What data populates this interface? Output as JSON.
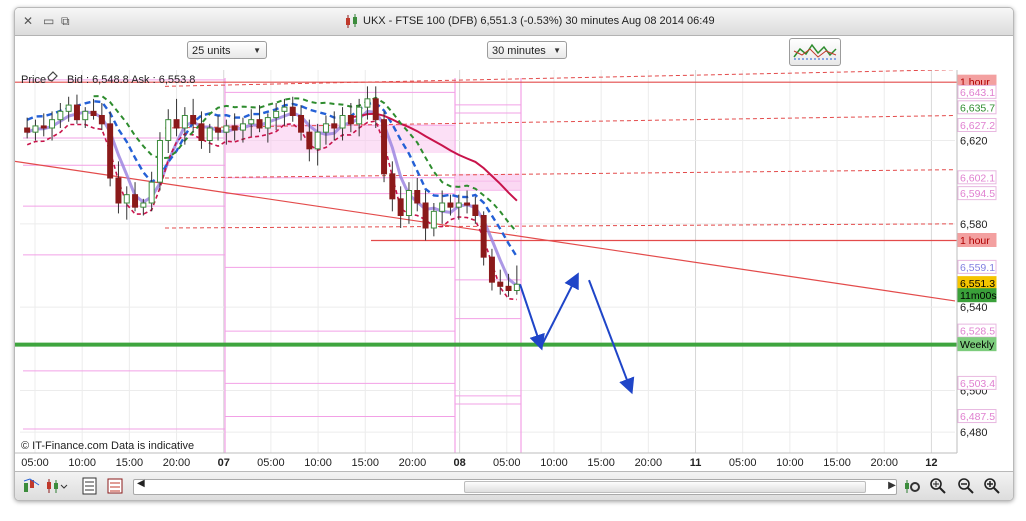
{
  "window": {
    "title": "UKX - FTSE 100 (DFB)   6,551.3 (-0.53%)   30 minutes  Aug 08 2014 06:49",
    "title_icons": [
      "close-icon",
      "minimize-icon",
      "detach-icon",
      "candlestick-icon"
    ]
  },
  "controls": {
    "units_select": "25 units",
    "timeframe_select": "30 minutes"
  },
  "chart": {
    "price_label": "Price",
    "bid_ask": "Bid : 6,548.8  Ask : 6,553.8",
    "watermark": "© IT-Finance.com  Data is indicative",
    "colors": {
      "candle_up": "#3c8c3c",
      "candle_down": "#8b1a1a",
      "resistance": "#e34b4b",
      "pink_lines": "#f2a0e6",
      "weekly": "#3ea53e",
      "blue_dash": "#2460d6",
      "ma_lavender": "#9d86e0",
      "maroon": "#c8144b",
      "green_dash": "#2e8c2e",
      "arrow": "#1f45c8"
    }
  },
  "chart_data": {
    "type": "candlestick",
    "instrument": "UKX - FTSE 100 (DFB)",
    "timeframe": "30 minutes",
    "last_price": 6551.3,
    "change_pct": -0.53,
    "ylim": [
      6470,
      6650
    ],
    "x_ticks": [
      "05:00",
      "10:00",
      "15:00",
      "20:00",
      "07",
      "05:00",
      "10:00",
      "15:00",
      "20:00",
      "08",
      "05:00",
      "10:00",
      "15:00",
      "20:00",
      "11",
      "05:00",
      "10:00",
      "15:00",
      "20:00",
      "12"
    ],
    "y_axis": {
      "ticks": [
        {
          "value": 6620,
          "label": "6,620"
        },
        {
          "value": 6580,
          "label": "6,580"
        },
        {
          "value": 6540,
          "label": "6,540"
        },
        {
          "value": 6500,
          "label": "6,500"
        },
        {
          "value": 6480,
          "label": "6,480"
        }
      ],
      "markers": [
        {
          "label": "1 hour",
          "value": 6648,
          "color": "#f3a0a0",
          "text": "#b00000"
        },
        {
          "label": "6,643.1",
          "value": 6643.1,
          "color": "#ffffff",
          "text": "#e080d0"
        },
        {
          "label": "6,635.7",
          "value": 6635.7,
          "color": "#ffffff",
          "text": "#2e8c2e"
        },
        {
          "label": "6,627.2",
          "value": 6627.2,
          "color": "#ffffff",
          "text": "#e080d0"
        },
        {
          "label": "6,602.1",
          "value": 6602.1,
          "color": "#ffffff",
          "text": "#e080d0"
        },
        {
          "label": "6,594.5",
          "value": 6594.5,
          "color": "#ffffff",
          "text": "#e080d0"
        },
        {
          "label": "1 hour",
          "value": 6572,
          "color": "#f3a0a0",
          "text": "#b00000"
        },
        {
          "label": "6,559.1",
          "value": 6559.1,
          "color": "#ffffff",
          "text": "#8080e0"
        },
        {
          "label": "6,551.3",
          "value": 6551.3,
          "color": "#f5c400",
          "text": "#000000"
        },
        {
          "label": "11m00s",
          "value": 6545.5,
          "color": "#3aa03a",
          "text": "#000000"
        },
        {
          "label": "6,528.5",
          "value": 6528.5,
          "color": "#ffffff",
          "text": "#e080d0"
        },
        {
          "label": "Weekly",
          "value": 6522,
          "color": "#7ccc7c",
          "text": "#000000"
        },
        {
          "label": "6,503.4",
          "value": 6503.4,
          "color": "#ffffff",
          "text": "#e080d0"
        },
        {
          "label": "6,487.5",
          "value": 6487.5,
          "color": "#ffffff",
          "text": "#e080d0"
        }
      ]
    },
    "candles": [
      {
        "o": 6626,
        "h": 6631,
        "l": 6621,
        "c": 6624
      },
      {
        "o": 6624,
        "h": 6630,
        "l": 6620,
        "c": 6627
      },
      {
        "o": 6627,
        "h": 6633,
        "l": 6622,
        "c": 6626
      },
      {
        "o": 6626,
        "h": 6634,
        "l": 6620,
        "c": 6630
      },
      {
        "o": 6630,
        "h": 6638,
        "l": 6626,
        "c": 6634
      },
      {
        "o": 6634,
        "h": 6641,
        "l": 6629,
        "c": 6637
      },
      {
        "o": 6637,
        "h": 6642,
        "l": 6628,
        "c": 6630
      },
      {
        "o": 6630,
        "h": 6636,
        "l": 6626,
        "c": 6634
      },
      {
        "o": 6634,
        "h": 6640,
        "l": 6630,
        "c": 6632
      },
      {
        "o": 6632,
        "h": 6638,
        "l": 6625,
        "c": 6628
      },
      {
        "o": 6628,
        "h": 6634,
        "l": 6598,
        "c": 6602
      },
      {
        "o": 6602,
        "h": 6610,
        "l": 6585,
        "c": 6590
      },
      {
        "o": 6590,
        "h": 6598,
        "l": 6582,
        "c": 6594
      },
      {
        "o": 6594,
        "h": 6600,
        "l": 6586,
        "c": 6588
      },
      {
        "o": 6588,
        "h": 6592,
        "l": 6584,
        "c": 6590
      },
      {
        "o": 6590,
        "h": 6605,
        "l": 6586,
        "c": 6600
      },
      {
        "o": 6600,
        "h": 6624,
        "l": 6596,
        "c": 6620
      },
      {
        "o": 6620,
        "h": 6635,
        "l": 6614,
        "c": 6630
      },
      {
        "o": 6630,
        "h": 6640,
        "l": 6622,
        "c": 6626
      },
      {
        "o": 6626,
        "h": 6636,
        "l": 6618,
        "c": 6632
      },
      {
        "o": 6632,
        "h": 6640,
        "l": 6624,
        "c": 6628
      },
      {
        "o": 6628,
        "h": 6634,
        "l": 6616,
        "c": 6620
      },
      {
        "o": 6620,
        "h": 6628,
        "l": 6614,
        "c": 6626
      },
      {
        "o": 6626,
        "h": 6632,
        "l": 6620,
        "c": 6624
      },
      {
        "o": 6624,
        "h": 6630,
        "l": 6618,
        "c": 6627
      },
      {
        "o": 6627,
        "h": 6633,
        "l": 6620,
        "c": 6625
      },
      {
        "o": 6625,
        "h": 6631,
        "l": 6619,
        "c": 6628
      },
      {
        "o": 6628,
        "h": 6635,
        "l": 6622,
        "c": 6630
      },
      {
        "o": 6630,
        "h": 6637,
        "l": 6624,
        "c": 6626
      },
      {
        "o": 6626,
        "h": 6633,
        "l": 6619,
        "c": 6631
      },
      {
        "o": 6631,
        "h": 6638,
        "l": 6625,
        "c": 6634
      },
      {
        "o": 6634,
        "h": 6640,
        "l": 6627,
        "c": 6636
      },
      {
        "o": 6636,
        "h": 6641,
        "l": 6629,
        "c": 6632
      },
      {
        "o": 6632,
        "h": 6637,
        "l": 6620,
        "c": 6624
      },
      {
        "o": 6624,
        "h": 6630,
        "l": 6610,
        "c": 6616
      },
      {
        "o": 6616,
        "h": 6628,
        "l": 6608,
        "c": 6624
      },
      {
        "o": 6624,
        "h": 6632,
        "l": 6618,
        "c": 6628
      },
      {
        "o": 6628,
        "h": 6634,
        "l": 6620,
        "c": 6626
      },
      {
        "o": 6626,
        "h": 6636,
        "l": 6620,
        "c": 6632
      },
      {
        "o": 6632,
        "h": 6638,
        "l": 6624,
        "c": 6628
      },
      {
        "o": 6628,
        "h": 6640,
        "l": 6622,
        "c": 6636
      },
      {
        "o": 6636,
        "h": 6646,
        "l": 6630,
        "c": 6640
      },
      {
        "o": 6640,
        "h": 6646,
        "l": 6626,
        "c": 6630
      },
      {
        "o": 6630,
        "h": 6634,
        "l": 6600,
        "c": 6604
      },
      {
        "o": 6604,
        "h": 6610,
        "l": 6586,
        "c": 6592
      },
      {
        "o": 6592,
        "h": 6598,
        "l": 6578,
        "c": 6584
      },
      {
        "o": 6584,
        "h": 6600,
        "l": 6580,
        "c": 6596
      },
      {
        "o": 6596,
        "h": 6602,
        "l": 6586,
        "c": 6590
      },
      {
        "o": 6590,
        "h": 6596,
        "l": 6572,
        "c": 6578
      },
      {
        "o": 6578,
        "h": 6590,
        "l": 6574,
        "c": 6586
      },
      {
        "o": 6586,
        "h": 6596,
        "l": 6580,
        "c": 6590
      },
      {
        "o": 6590,
        "h": 6594,
        "l": 6584,
        "c": 6588
      },
      {
        "o": 6588,
        "h": 6594,
        "l": 6582,
        "c": 6590
      },
      {
        "o": 6590,
        "h": 6596,
        "l": 6585,
        "c": 6589
      },
      {
        "o": 6589,
        "h": 6593,
        "l": 6580,
        "c": 6584
      },
      {
        "o": 6584,
        "h": 6586,
        "l": 6560,
        "c": 6564
      },
      {
        "o": 6564,
        "h": 6568,
        "l": 6548,
        "c": 6552
      },
      {
        "o": 6552,
        "h": 6558,
        "l": 6546,
        "c": 6550
      },
      {
        "o": 6550,
        "h": 6556,
        "l": 6545,
        "c": 6548
      },
      {
        "o": 6548,
        "h": 6560,
        "l": 6546,
        "c": 6551
      }
    ],
    "overlay_lines": [
      {
        "kind": "resistance-1hour",
        "value": 6648
      },
      {
        "kind": "resistance-1hour",
        "value": 6572
      },
      {
        "kind": "weekly-support",
        "value": 6522
      }
    ]
  },
  "bottombar": {
    "left_icons": [
      "chart-type-icon",
      "indicator-icon",
      "list-icon",
      "drawing-tools-icon"
    ],
    "right_icons": [
      "scroll-right-icon",
      "settings-icon",
      "zoom-fit-icon",
      "zoom-out-icon",
      "zoom-in-icon"
    ]
  }
}
